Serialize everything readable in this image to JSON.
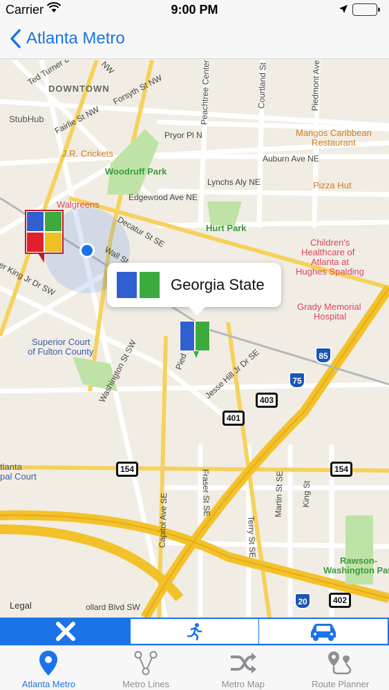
{
  "status_bar": {
    "carrier": "Carrier",
    "time": "9:00 PM"
  },
  "nav": {
    "back_label": "Atlanta Metro"
  },
  "map": {
    "labels": {
      "downtown": "DOWNTOWN",
      "stubhub": "StubHub",
      "jr_crickets": "J.R. Crickets",
      "woodruff_park": "Woodruff Park",
      "walgreens": "Walgreens",
      "hurt_park": "Hurt Park",
      "mangos_1": "Mangos Caribbean",
      "mangos_2": "Restaurant",
      "pizza_hut": "Pizza Hut",
      "childrens_1": "Children's",
      "childrens_2": "Healthcare of",
      "childrens_3": "Atlanta at",
      "childrens_4": "Hughes Spalding",
      "grady_1": "Grady Memorial",
      "grady_2": "Hospital",
      "superior_1": "Superior Court",
      "superior_2": "of Fulton County",
      "rawson_1": "Rawson-",
      "rawson_2": "Washington Par",
      "atlanta_partial": "tlanta",
      "city_court_partial": "pal Court",
      "legal": "Legal"
    },
    "streets": {
      "ted_turner": "Ted Turner D",
      "forsyth": "Forsyth St NW",
      "fairlie": "Fairlie St NW",
      "peachtree": "Peachtree Center",
      "courtland": "Courtland St",
      "piedmont": "Piedmont Ave",
      "pryor": "Pryor Pl N",
      "auburn": "Auburn Ave NE",
      "lynchs": "Lynchs Aly NE",
      "edgewood": "Edgewood Ave NE",
      "decatur": "Decatur St SE",
      "wall": "Wall St",
      "king": "er King Jr Dr SW",
      "washington": "Washington St SW",
      "piedmont_short": "Pied",
      "jesse_hill": "Jesse Hill Jr Dr SE",
      "capitol": "Capitol Ave SE",
      "fraser": "Fraser St SE",
      "terry": "Terry St SE",
      "martin": "Martin St SE",
      "king_st": "King St",
      "pollard": "ollard Blvd SW",
      "nw": "NW"
    },
    "shields": {
      "i85": "85",
      "i75": "75",
      "i20": "20",
      "us403": "403",
      "us401": "401",
      "us154_left": "154",
      "us154_right": "154",
      "us402": "402"
    },
    "callout": {
      "station_name": "Georgia State",
      "flag_colors": [
        "#2f5fd0",
        "#3daa3d"
      ]
    },
    "station_flag_colors": [
      "#2f5fd0",
      "#3daa3d",
      "#e0202a",
      "#f0c020"
    ]
  },
  "mode_bar": {
    "accent": "#1a73e8",
    "options": [
      "close-icon",
      "walking-icon",
      "car-icon"
    ]
  },
  "tabs": [
    {
      "label": "Atlanta Metro",
      "icon": "location-pin-icon",
      "active": true
    },
    {
      "label": "Metro Lines",
      "icon": "branches-icon",
      "active": false
    },
    {
      "label": "Metro Map",
      "icon": "shuffle-icon",
      "active": false
    },
    {
      "label": "Route Planner",
      "icon": "route-icon",
      "active": false
    }
  ]
}
